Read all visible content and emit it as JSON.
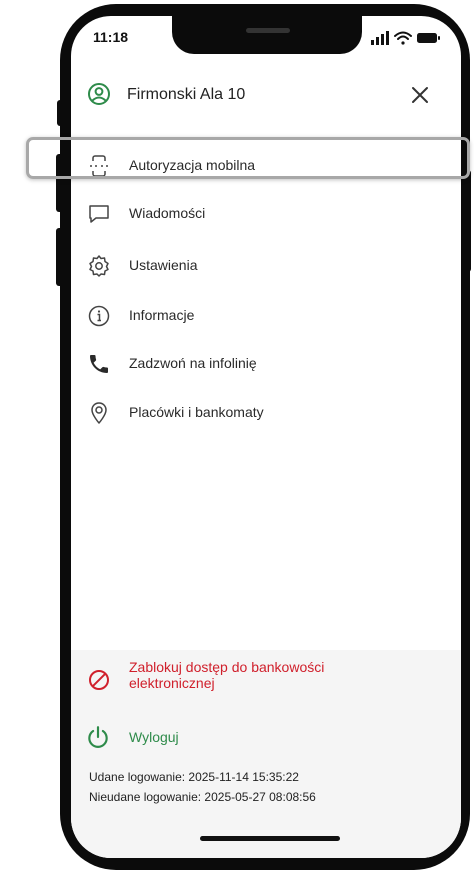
{
  "status_bar": {
    "time": "11:18",
    "icons": [
      "signal-icon",
      "wifi-icon",
      "battery-icon"
    ]
  },
  "header": {
    "user_name": "Firmonski Ala 10",
    "user_icon": "user-circle-icon",
    "close_icon": "close-icon"
  },
  "menu": {
    "items": [
      {
        "label": "Autoryzacja mobilna",
        "icon": "mobile-authorization-icon",
        "highlighted": true
      },
      {
        "label": "Wiadomości",
        "icon": "message-icon"
      },
      {
        "label": "Ustawienia",
        "icon": "gear-icon"
      },
      {
        "label": "Informacje",
        "icon": "info-icon"
      },
      {
        "label": "Zadzwoń na infolinię",
        "icon": "phone-icon"
      },
      {
        "label": "Placówki i bankomaty",
        "icon": "location-pin-icon"
      }
    ]
  },
  "block_access": {
    "label": "Zablokuj dostęp do bankowości elektronicznej",
    "icon": "block-icon",
    "color": "#d0202c"
  },
  "logout": {
    "label": "Wyloguj",
    "icon": "power-icon",
    "color": "#2e8b4a"
  },
  "login_info": {
    "success": "Udane logowanie: 2025-11-14 15:35:22",
    "failed": "Nieudane logowanie: 2025-05-27 08:08:56"
  },
  "colors": {
    "accent_green": "#2e8b4a",
    "danger_red": "#d0202c",
    "footer_background": "#f5f5f5"
  }
}
